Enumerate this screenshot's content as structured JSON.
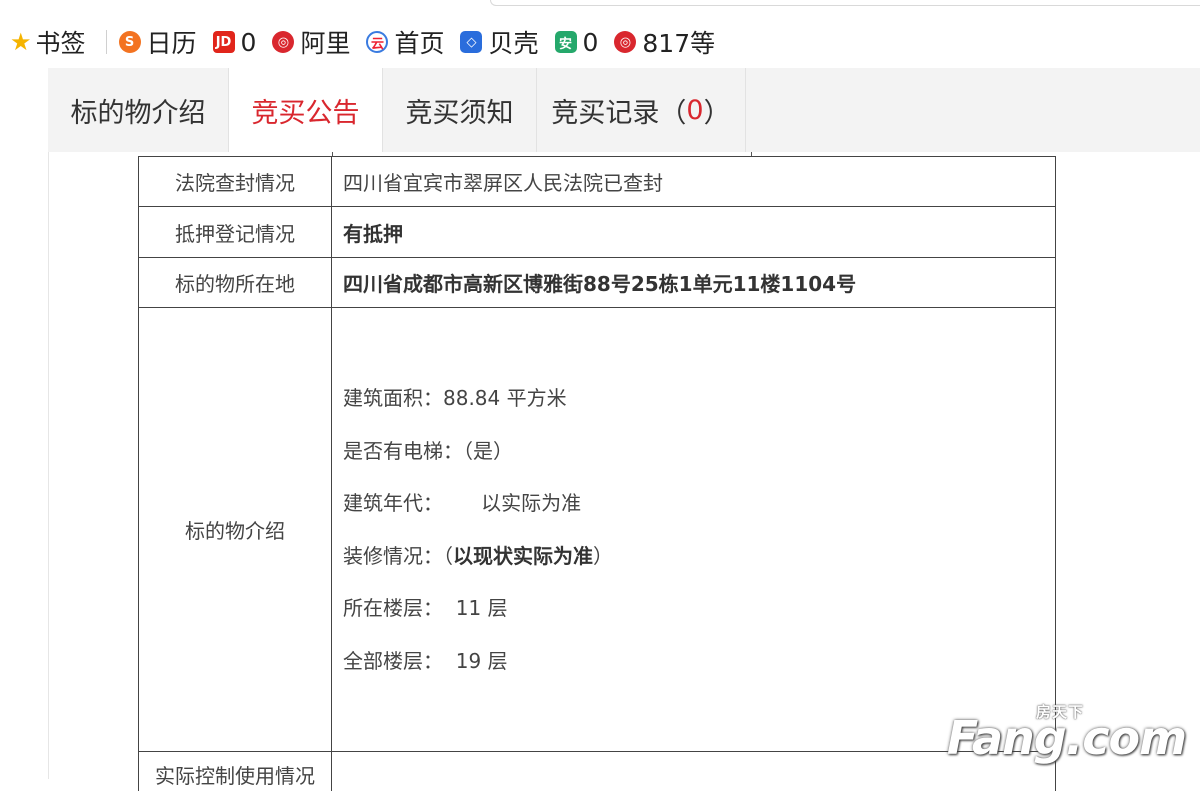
{
  "bookmarks": [
    {
      "name": "bookmark-star",
      "label": "书签"
    },
    {
      "name": "bookmark-rili",
      "icon": "S",
      "label": "日历"
    },
    {
      "name": "bookmark-jd",
      "icon": "JD",
      "label": "0"
    },
    {
      "name": "bookmark-ali",
      "icon": "◎",
      "label": "阿里"
    },
    {
      "name": "bookmark-home",
      "icon": "云",
      "label": "首页"
    },
    {
      "name": "bookmark-beike",
      "icon": "◇",
      "label": "贝壳"
    },
    {
      "name": "bookmark-an",
      "icon": "安",
      "label": "0"
    },
    {
      "name": "bookmark-817",
      "icon": "◎",
      "label": "817等"
    }
  ],
  "tabs": {
    "intro": "标的物介绍",
    "notice": "竞买公告",
    "rules": "竞买须知",
    "records": "竞买记录",
    "records_open": "（",
    "records_count": "0",
    "records_close": "）"
  },
  "table": {
    "seal_label": "法院查封情况",
    "seal_value": "四川省宜宾市翠屏区人民法院已查封",
    "mortgage_label": "抵押登记情况",
    "mortgage_value": "有抵押",
    "location_label": "标的物所在地",
    "location_value": "四川省成都市高新区博雅街88号25栋1单元11楼1104号",
    "intro_label": "标的物介绍",
    "intro_lines": {
      "area": "建筑面积：88.84 平方米",
      "elevator": "是否有电梯：（是）",
      "year": "建筑年代：      以实际为准",
      "deco_prefix": "装修情况：（",
      "deco_bold": "以现状实际为准",
      "deco_suffix": "）",
      "floor": "所在楼层：  11 层",
      "total": "全部楼层：  19 层"
    },
    "control_label": "实际控制使用情况"
  },
  "watermark": {
    "cn": "房天下",
    "en": "Fang.com"
  }
}
